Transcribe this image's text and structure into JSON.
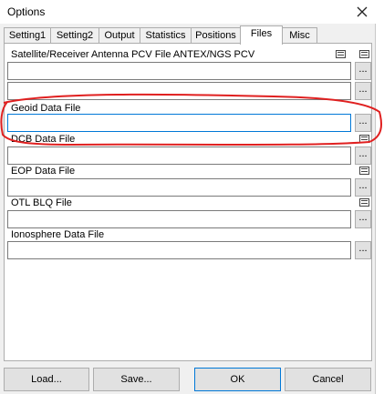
{
  "window": {
    "title": "Options"
  },
  "icons": {
    "close": "close-icon",
    "view": "view-file-icon",
    "browse": "browse-ellipsis-icon"
  },
  "tabs": [
    {
      "label": "Setting1"
    },
    {
      "label": "Setting2"
    },
    {
      "label": "Output"
    },
    {
      "label": "Statistics"
    },
    {
      "label": "Positions"
    },
    {
      "label": "Files",
      "active": true
    },
    {
      "label": "Misc"
    }
  ],
  "files": {
    "antenna": {
      "label": "Satellite/Receiver Antenna PCV File ANTEX/NGS PCV",
      "value1": "",
      "value2": "",
      "browse": "..."
    },
    "geoid": {
      "label": "Geoid Data File",
      "value": "",
      "browse": "..."
    },
    "dcb": {
      "label": "DCB Data File",
      "value": "",
      "browse": "..."
    },
    "eop": {
      "label": "EOP Data File",
      "value": "",
      "browse": "..."
    },
    "otl": {
      "label": "OTL BLQ File",
      "value": "",
      "browse": "..."
    },
    "ionosphere": {
      "label": "Ionosphere Data File",
      "value": "",
      "browse": "..."
    }
  },
  "buttons": {
    "load": "Load...",
    "save": "Save...",
    "ok": "OK",
    "cancel": "Cancel"
  },
  "colors": {
    "annotation": "#e02020",
    "focus": "#0078d7"
  }
}
